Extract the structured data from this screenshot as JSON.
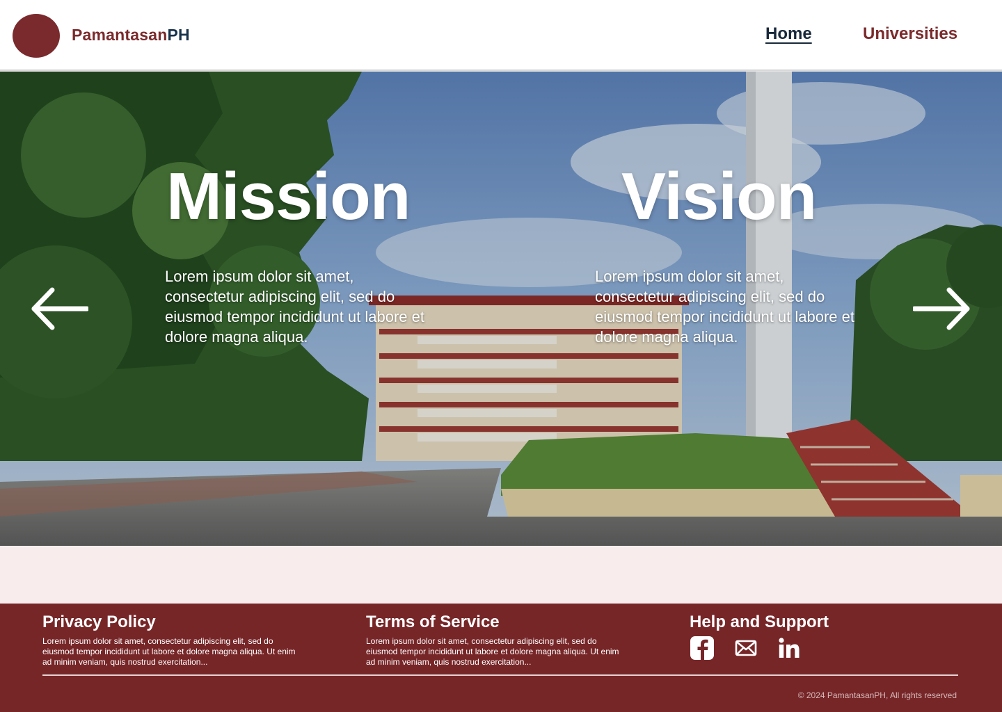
{
  "header": {
    "brand_part1": "Pamantasan",
    "brand_part2": "PH",
    "nav": {
      "home": "Home",
      "universities": "Universities"
    }
  },
  "hero": {
    "mission": {
      "title": "Mission",
      "text": "Lorem ipsum dolor sit amet, consectetur adipiscing elit, sed do eiusmod tempor incididunt ut labore et dolore magna aliqua."
    },
    "vision": {
      "title": "Vision",
      "text": "Lorem ipsum dolor sit amet, consectetur adipiscing elit, sed do eiusmod tempor incididunt ut labore et dolore magna aliqua."
    },
    "prev_icon": "arrow-left-icon",
    "next_icon": "arrow-right-icon"
  },
  "footer": {
    "privacy": {
      "title": "Privacy Policy",
      "text": "Lorem ipsum dolor sit amet, consectetur adipiscing elit, sed do eiusmod tempor incididunt ut labore et dolore magna aliqua. Ut enim ad minim veniam, quis nostrud exercitation..."
    },
    "terms": {
      "title": "Terms of Service",
      "text": "Lorem ipsum dolor sit amet, consectetur adipiscing elit, sed do eiusmod tempor incididunt ut labore et dolore magna aliqua. Ut enim ad minim veniam, quis nostrud exercitation..."
    },
    "help": {
      "title": "Help and Support",
      "icons": [
        "facebook-icon",
        "mail-icon",
        "linkedin-icon"
      ]
    },
    "copyright": "© 2024 PamantasanPH, All rights reserved"
  },
  "colors": {
    "brand_maroon": "#7a2a2c",
    "brand_navy": "#17324a",
    "footer_bg": "#772628",
    "band_bg": "#f8eced"
  }
}
